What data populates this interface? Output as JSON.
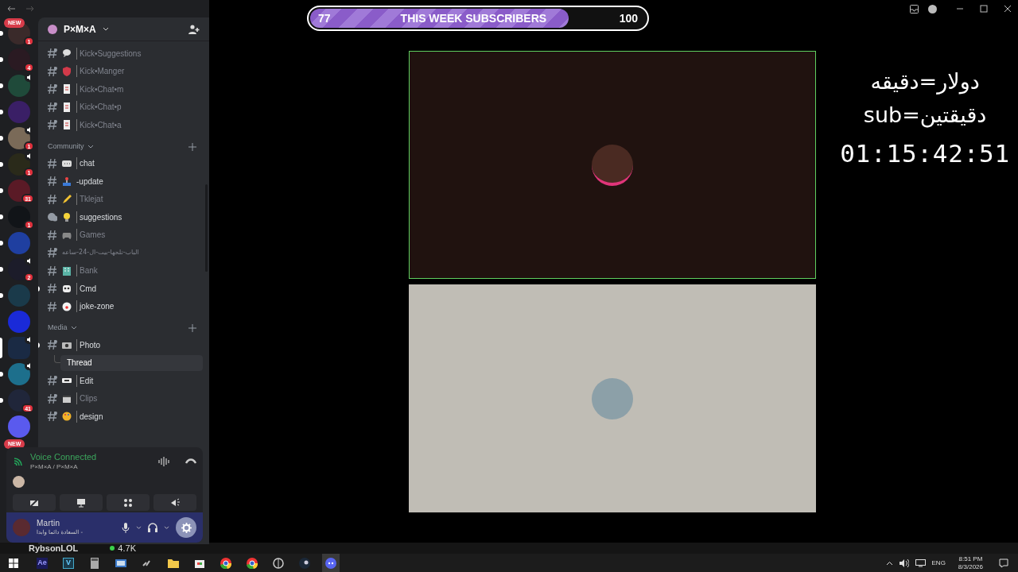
{
  "server_name": "P×M×A",
  "servers": [
    {
      "color": "#3a2a2a",
      "badge": "1",
      "new_pill": "NEW",
      "speaker": false,
      "unread": true,
      "selected": false
    },
    {
      "color": "#2a1a22",
      "badge": "4",
      "speaker": false,
      "unread": true,
      "selected": false
    },
    {
      "color": "#1f4a3a",
      "speaker": true,
      "unread": true,
      "selected": false
    },
    {
      "color": "#3a1f66",
      "speaker": false,
      "unread": true,
      "selected": false
    },
    {
      "color": "#7a6a58",
      "badge": "1",
      "speaker": true,
      "unread": true,
      "selected": false
    },
    {
      "color": "#2a2a1a",
      "badge": "1",
      "speaker": true,
      "unread": true,
      "selected": false
    },
    {
      "color": "#5a1a26",
      "badge": "31",
      "speaker": false,
      "unread": true,
      "selected": false
    },
    {
      "color": "#111418",
      "badge": "1",
      "speaker": false,
      "unread": true,
      "selected": false
    },
    {
      "color": "#1f3fa0",
      "speaker": false,
      "unread": true,
      "selected": false
    },
    {
      "color": "#1c1c2a",
      "badge": "2",
      "speaker": true,
      "unread": true,
      "selected": false
    },
    {
      "color": "#1a3a4a",
      "speaker": false,
      "unread": true,
      "selected": false
    },
    {
      "color": "#1a2ad8",
      "speaker": false,
      "unread": false,
      "selected": false
    },
    {
      "color": "#1a2a44",
      "speaker": true,
      "unread": false,
      "selected": true
    },
    {
      "color": "#1d6f8c",
      "speaker": true,
      "unread": true,
      "selected": false
    },
    {
      "color": "#20263a",
      "badge": "41",
      "speaker": false,
      "unread": true,
      "selected": false
    },
    {
      "color": "#5a5aee",
      "new_pill": "NEW",
      "speaker": false,
      "unread": false,
      "selected": false
    }
  ],
  "groups": [
    {
      "channels": [
        {
          "name": "Kick•Suggestions",
          "kind": "bubble",
          "thread": true,
          "unread": false
        },
        {
          "name": "Kick•Manger",
          "kind": "shield",
          "thread": true,
          "unread": false
        },
        {
          "name": "Kick•Chat•m",
          "kind": "doc",
          "thread": true,
          "unread": false
        },
        {
          "name": "Kick•Chat•p",
          "kind": "doc",
          "thread": true,
          "unread": false
        },
        {
          "name": "Kick•Chat•a",
          "kind": "doc",
          "thread": true,
          "unread": false
        }
      ]
    },
    {
      "category": "Community",
      "channels": [
        {
          "name": "chat",
          "kind": "chat",
          "thread": false,
          "unread": true
        },
        {
          "name": "-update",
          "kind": "joystick",
          "thread": false,
          "unread": true,
          "no_bar": true
        },
        {
          "name": "Tklejat",
          "kind": "pencil",
          "thread": false,
          "unread": false
        },
        {
          "name": "suggestions",
          "kind": "bulb",
          "unread": true,
          "forum": true
        },
        {
          "name": "Games",
          "kind": "gamepad",
          "thread": false,
          "unread": false
        },
        {
          "name": "الباب-تلحها-بيت-ال-24-ساعه",
          "thread": true,
          "unread": false
        },
        {
          "name": "Bank",
          "kind": "building",
          "thread": false,
          "unread": false
        },
        {
          "name": "Cmd",
          "kind": "robot",
          "thread": false,
          "unread": true,
          "dot": true
        },
        {
          "name": "joke-zone",
          "kind": "clown",
          "thread": false,
          "unread": true
        }
      ]
    },
    {
      "category": "Media",
      "channels": [
        {
          "name": "Photo",
          "kind": "camera",
          "thread": true,
          "unread": true,
          "dot": true,
          "children": [
            {
              "name": "Thread",
              "selected": true
            }
          ]
        },
        {
          "name": "Edit",
          "kind": "tape",
          "thread": true,
          "unread": true
        },
        {
          "name": "Clips",
          "kind": "clapper",
          "thread": true,
          "unread": false
        },
        {
          "name": "design",
          "kind": "palette",
          "thread": true,
          "unread": true
        }
      ]
    }
  ],
  "voice": {
    "status": "Voice Connected",
    "location": "P×M×A / P×M×A"
  },
  "user": {
    "name": "Martin",
    "status": "السعادة دائما وابدا -"
  },
  "behind_panel": {
    "name": "RybsonLOL",
    "count": "4.7K"
  },
  "subscribers": {
    "current": "77",
    "title": "THIS WEEK SUBSCRIBERS",
    "goal": "100",
    "level": 0.77
  },
  "overlay": {
    "lines": [
      "دولار=دقيقه",
      "sub=دقيقتين"
    ],
    "timer": "01:15:42:51"
  },
  "taskbar": {
    "apps": [
      {
        "kind": "ae",
        "label": "Ae"
      },
      {
        "kind": "v",
        "label": "V"
      },
      {
        "kind": "calc"
      },
      {
        "kind": "window"
      },
      {
        "kind": "link"
      },
      {
        "kind": "folder"
      },
      {
        "kind": "store"
      },
      {
        "kind": "chrome"
      },
      {
        "kind": "chrome"
      },
      {
        "kind": "game"
      },
      {
        "kind": "steam"
      },
      {
        "kind": "discord",
        "active": true
      }
    ],
    "lang": "ENG",
    "time": "8:51 PM",
    "date": "8/3/2026"
  }
}
